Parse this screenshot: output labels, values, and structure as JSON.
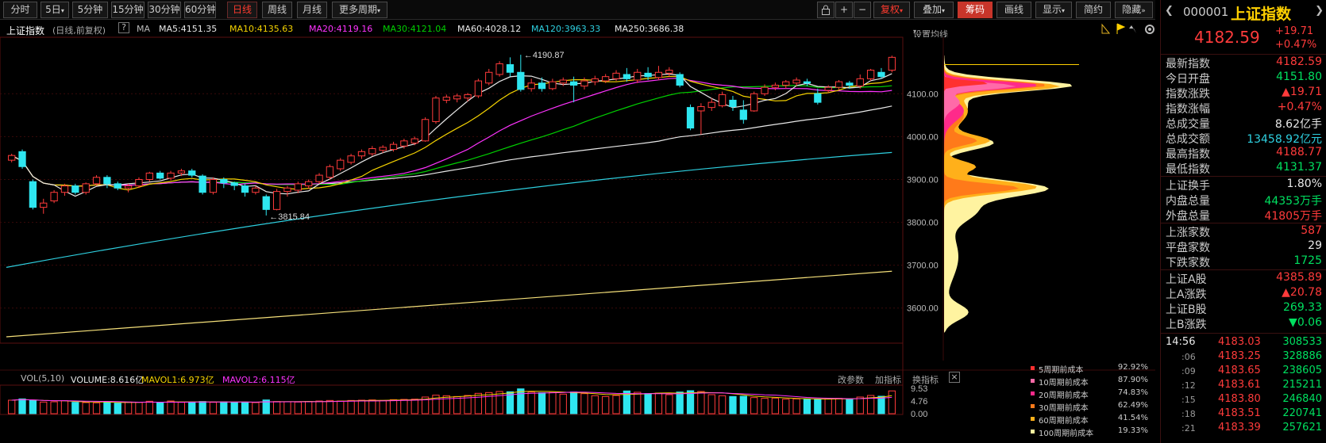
{
  "toolbar": {
    "periods": [
      "分时",
      "5日",
      "5分钟",
      "15分钟",
      "30分钟",
      "60分钟",
      "日线",
      "周线",
      "月线",
      "更多周期"
    ],
    "active_period": "日线",
    "right_buttons": [
      "复权",
      "叠加",
      "筹码",
      "画线",
      "显示",
      "简约",
      "隐藏"
    ],
    "plus": "+",
    "minus": "−"
  },
  "chart_legend": {
    "title": "上证指数",
    "subtitle": "(日线,前复权)",
    "help": "?",
    "ma_label": "MA",
    "ma5": "MA5:4151.35",
    "ma10": "MA10:4135.63",
    "ma20": "MA20:4119.16",
    "ma30": "MA30:4121.04",
    "ma60": "MA60:4028.12",
    "ma120": "MA120:3963.33",
    "ma250": "MA250:3686.38",
    "settings": "设置均线"
  },
  "vol_legend": {
    "label": "VOL(5,10)",
    "volume": "VOLUME:8.616亿",
    "mavol1": "MAVOL1:6.973亿",
    "mavol2": "MAVOL2:6.115亿",
    "adjust": "改参数",
    "add": "加指标",
    "change": "换指标",
    "close": "×"
  },
  "price_annotations": {
    "high": "4190.87",
    "low": "3815.84"
  },
  "chip": {
    "rows": [
      {
        "label": "5周期前成本",
        "value": "92.92%",
        "color": "#ff3030"
      },
      {
        "label": "10周期前成本",
        "value": "87.90%",
        "color": "#ff6aa8"
      },
      {
        "label": "20周期前成本",
        "value": "74.83%",
        "color": "#ff2a8a"
      },
      {
        "label": "30周期前成本",
        "value": "62.49%",
        "color": "#ff7a1a"
      },
      {
        "label": "60周期前成本",
        "value": "41.54%",
        "color": "#ffb01a"
      },
      {
        "label": "100周期前成本",
        "value": "19.33%",
        "color": "#fff3a0"
      }
    ]
  },
  "panel": {
    "code": "000001",
    "name": "上证指数",
    "price": "4182.59",
    "change": "+19.71",
    "change_pct": "+0.47%",
    "rows": [
      {
        "label": "最新指数",
        "value": "4182.59",
        "color": "#ff3b3b"
      },
      {
        "label": "今日开盘",
        "value": "4151.80",
        "color": "#00e060"
      },
      {
        "label": "指数涨跌",
        "value": "▲19.71",
        "color": "#ff3b3b"
      },
      {
        "label": "指数涨幅",
        "value": "+0.47%",
        "color": "#ff3b3b"
      },
      {
        "label": "总成交量",
        "value": "8.62亿手",
        "color": "#e8e8e8"
      },
      {
        "label": "总成交额",
        "value": "13458.92亿元",
        "color": "#2ed0e0"
      },
      {
        "label": "最高指数",
        "value": "4188.77",
        "color": "#ff3b3b"
      },
      {
        "label": "最低指数",
        "value": "4131.37",
        "color": "#00e060"
      },
      {
        "label": "上证换手",
        "value": "1.80%",
        "color": "#e8e8e8"
      },
      {
        "label": "内盘总量",
        "value": "44353万手",
        "color": "#00e060"
      },
      {
        "label": "外盘总量",
        "value": "41805万手",
        "color": "#ff3b3b"
      },
      {
        "label": "上涨家数",
        "value": "587",
        "color": "#ff3b3b"
      },
      {
        "label": "平盘家数",
        "value": "29",
        "color": "#e8e8e8"
      },
      {
        "label": "下跌家数",
        "value": "1725",
        "color": "#00e060"
      },
      {
        "label": "上证A股",
        "value": "4385.89",
        "color": "#ff3b3b"
      },
      {
        "label": "上A涨跌",
        "value": "▲20.78",
        "color": "#ff3b3b"
      },
      {
        "label": "上证B股",
        "value": "269.33",
        "color": "#00e060"
      },
      {
        "label": "上B涨跌",
        "value": "▼0.06",
        "color": "#00e060"
      }
    ],
    "ticks": [
      {
        "time": "14:56",
        "price": "4183.03",
        "vol": "308533"
      },
      {
        "time": ":06",
        "price": "4183.25",
        "vol": "328886"
      },
      {
        "time": ":09",
        "price": "4183.65",
        "vol": "238605"
      },
      {
        "time": ":12",
        "price": "4183.61",
        "vol": "215211"
      },
      {
        "time": ":15",
        "price": "4183.80",
        "vol": "246840"
      },
      {
        "time": ":18",
        "price": "4183.51",
        "vol": "220741"
      },
      {
        "time": ":21",
        "price": "4183.39",
        "vol": "257621"
      }
    ]
  },
  "colors": {
    "up": "#ff3b3b",
    "down": "#2ee6f0",
    "ma5": "#e8e8e8",
    "ma10": "#f5d300",
    "ma20": "#ff33ff",
    "ma30": "#00d000",
    "ma60": "#e8e8e8",
    "ma120": "#2ed0e0",
    "ma250": "#f5e07a"
  },
  "chart_data": {
    "type": "candlestick",
    "price_ticks": [
      3600,
      3700,
      3800,
      3900,
      4000,
      4100
    ],
    "price_range": [
      3520,
      4230
    ],
    "vol_ticks": [
      "9.53",
      "4.76",
      "0.00"
    ],
    "vol_range": [
      0,
      10.5
    ],
    "candles": [
      [
        3945,
        3956,
        3940,
        3960
      ],
      [
        3965,
        3930,
        3925,
        3970
      ],
      [
        3895,
        3835,
        3830,
        3900
      ],
      [
        3835,
        3845,
        3820,
        3855
      ],
      [
        3850,
        3870,
        3845,
        3875
      ],
      [
        3870,
        3885,
        3862,
        3890
      ],
      [
        3885,
        3870,
        3865,
        3890
      ],
      [
        3870,
        3890,
        3865,
        3893
      ],
      [
        3890,
        3905,
        3885,
        3910
      ],
      [
        3905,
        3890,
        3880,
        3910
      ],
      [
        3890,
        3880,
        3875,
        3895
      ],
      [
        3880,
        3885,
        3870,
        3890
      ],
      [
        3885,
        3900,
        3880,
        3905
      ],
      [
        3900,
        3915,
        3895,
        3918
      ],
      [
        3915,
        3903,
        3900,
        3920
      ],
      [
        3903,
        3915,
        3898,
        3920
      ],
      [
        3915,
        3920,
        3908,
        3925
      ],
      [
        3920,
        3910,
        3905,
        3925
      ],
      [
        3908,
        3870,
        3865,
        3912
      ],
      [
        3870,
        3900,
        3865,
        3905
      ],
      [
        3900,
        3892,
        3880,
        3905
      ],
      [
        3892,
        3886,
        3875,
        3895
      ],
      [
        3885,
        3870,
        3860,
        3890
      ],
      [
        3870,
        3880,
        3865,
        3885
      ],
      [
        3860,
        3830,
        3816,
        3865
      ],
      [
        3830,
        3872,
        3828,
        3878
      ],
      [
        3872,
        3880,
        3860,
        3885
      ],
      [
        3875,
        3890,
        3868,
        3895
      ],
      [
        3885,
        3895,
        3878,
        3900
      ],
      [
        3895,
        3910,
        3890,
        3915
      ],
      [
        3905,
        3930,
        3900,
        3935
      ],
      [
        3925,
        3945,
        3920,
        3950
      ],
      [
        3940,
        3955,
        3935,
        3960
      ],
      [
        3955,
        3965,
        3948,
        3970
      ],
      [
        3960,
        3972,
        3955,
        3978
      ],
      [
        3968,
        3975,
        3962,
        3980
      ],
      [
        3970,
        3982,
        3965,
        3988
      ],
      [
        3978,
        3990,
        3972,
        3995
      ],
      [
        3985,
        3995,
        3980,
        4000
      ],
      [
        3990,
        4040,
        3988,
        4045
      ],
      [
        4035,
        4090,
        4030,
        4095
      ],
      [
        4085,
        4092,
        4078,
        4098
      ],
      [
        4088,
        4095,
        4080,
        4100
      ],
      [
        4090,
        4098,
        4082,
        4102
      ],
      [
        4095,
        4130,
        4090,
        4135
      ],
      [
        4125,
        4150,
        4120,
        4158
      ],
      [
        4145,
        4170,
        4140,
        4176
      ],
      [
        4168,
        4150,
        4140,
        4185
      ],
      [
        4150,
        4110,
        4105,
        4191
      ],
      [
        4112,
        4125,
        4105,
        4135
      ],
      [
        4125,
        4112,
        4105,
        4138
      ],
      [
        4112,
        4128,
        4108,
        4135
      ],
      [
        4125,
        4132,
        4118,
        4138
      ],
      [
        4128,
        4120,
        4080,
        4140
      ],
      [
        4118,
        4130,
        4110,
        4138
      ],
      [
        4128,
        4135,
        4120,
        4142
      ],
      [
        4130,
        4140,
        4125,
        4146
      ],
      [
        4135,
        4148,
        4130,
        4155
      ],
      [
        4145,
        4135,
        4128,
        4160
      ],
      [
        4132,
        4150,
        4125,
        4158
      ],
      [
        4148,
        4140,
        4132,
        4162
      ],
      [
        4138,
        4150,
        4132,
        4165
      ],
      [
        4148,
        4155,
        4140,
        4162
      ],
      [
        4145,
        4120,
        4115,
        4150
      ],
      [
        4068,
        4020,
        4015,
        4075
      ],
      [
        4060,
        4070,
        4005,
        4078
      ],
      [
        4068,
        4080,
        4060,
        4090
      ],
      [
        4072,
        4098,
        4068,
        4105
      ],
      [
        4085,
        4070,
        4060,
        4095
      ],
      [
        4062,
        4040,
        4030,
        4085
      ],
      [
        4060,
        4100,
        4058,
        4105
      ],
      [
        4100,
        4115,
        4095,
        4122
      ],
      [
        4115,
        4120,
        4108,
        4126
      ],
      [
        4120,
        4128,
        4112,
        4132
      ],
      [
        4125,
        4132,
        4118,
        4138
      ],
      [
        4128,
        4125,
        4118,
        4135
      ],
      [
        4100,
        4080,
        4075,
        4112
      ],
      [
        4108,
        4115,
        4102,
        4120
      ],
      [
        4115,
        4128,
        4110,
        4132
      ],
      [
        4125,
        4120,
        4112,
        4130
      ],
      [
        4118,
        4135,
        4112,
        4145
      ],
      [
        4135,
        4155,
        4130,
        4158
      ],
      [
        4150,
        4140,
        4135,
        4160
      ],
      [
        4155,
        4185,
        4150,
        4189
      ]
    ],
    "volumes": [
      5.1,
      5.6,
      5.0,
      4.4,
      4.5,
      4.9,
      4.3,
      4.2,
      4.1,
      4.5,
      4.0,
      4.4,
      4.3,
      4.7,
      4.2,
      4.8,
      4.3,
      4.4,
      4.6,
      4.3,
      4.5,
      4.2,
      4.4,
      4.2,
      5.2,
      4.6,
      4.5,
      4.4,
      4.6,
      4.8,
      5.0,
      4.8,
      5.0,
      5.1,
      5.2,
      5.0,
      5.3,
      5.4,
      5.5,
      6.3,
      7.0,
      6.8,
      6.5,
      6.9,
      7.7,
      8.0,
      8.4,
      8.3,
      9.4,
      8.2,
      7.9,
      8.0,
      7.4,
      8.2,
      7.6,
      6.8,
      6.5,
      6.9,
      8.6,
      8.1,
      7.6,
      7.8,
      7.2,
      8.2,
      8.7,
      8.4,
      7.2,
      6.8,
      6.5,
      6.6,
      6.1,
      5.8,
      5.9,
      5.5,
      5.6,
      5.5,
      5.4,
      5.6,
      5.8,
      5.6,
      6.3,
      6.9,
      6.6,
      8.62
    ],
    "ma_series": {
      "ma250_ends": [
        3533,
        3686
      ],
      "ma120_ends": [
        3695,
        3963
      ]
    }
  }
}
